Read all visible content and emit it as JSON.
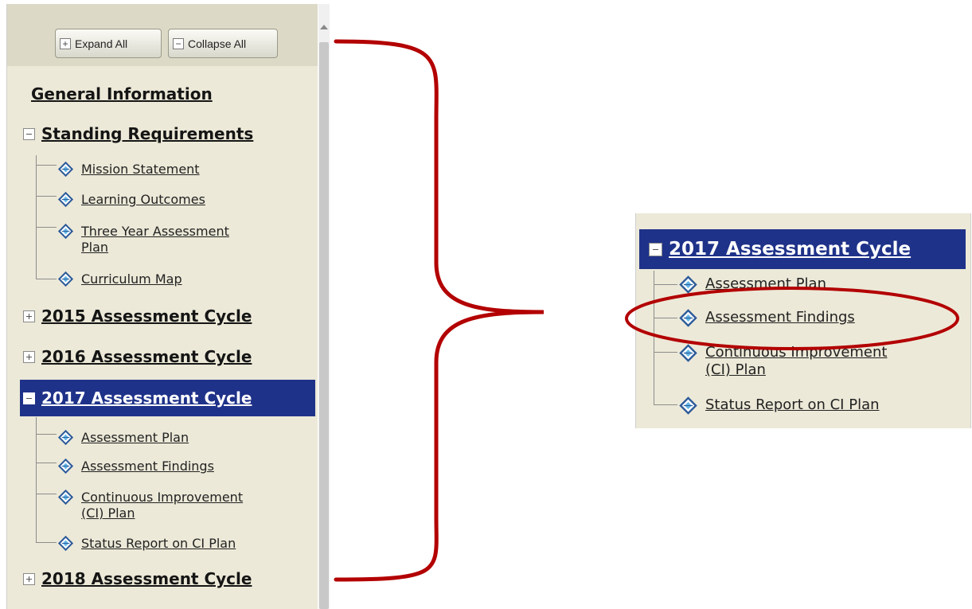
{
  "toolbar": {
    "expand_all": "Expand All",
    "collapse_all": "Collapse All"
  },
  "sidebar": {
    "general_information": "General Information",
    "standing_requirements": {
      "label": "Standing Requirements",
      "items": [
        "Mission Statement",
        "Learning Outcomes",
        "Three Year Assessment",
        "Plan",
        "Curriculum Map"
      ]
    },
    "cycle_2015": "2015 Assessment Cycle",
    "cycle_2016": "2016 Assessment Cycle",
    "cycle_2017": {
      "label": "2017 Assessment Cycle",
      "items": [
        "Assessment Plan",
        "Assessment Findings",
        "Continuous Improvement",
        "(CI) Plan",
        "Status Report on CI Plan"
      ]
    },
    "cycle_2018": "2018 Assessment Cycle"
  },
  "zoom": {
    "section_label": "2017 Assessment Cycle",
    "items": [
      "Assessment Plan",
      "Assessment Findings",
      "Continuous Improvement",
      "(CI) Plan",
      "Status Report on CI Plan"
    ]
  },
  "colors": {
    "selected_bg": "#1f3289",
    "annotation": "#b30000",
    "panel_bg": "#ece9d8"
  }
}
